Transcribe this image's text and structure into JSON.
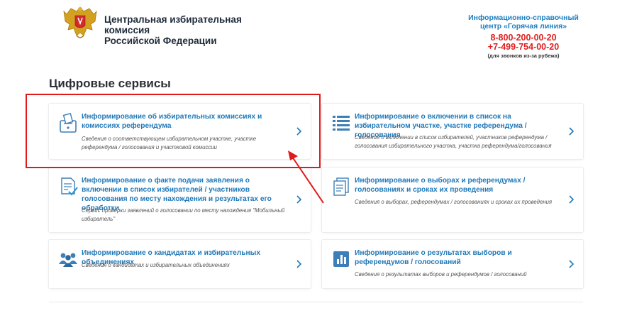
{
  "header": {
    "org_name_line1": "Центральная избирательная комиссия",
    "org_name_line2": "Российской Федерации",
    "hotline_title_line1": "Информационно-справочный",
    "hotline_title_line2": "центр «Горячая линия»",
    "phone1": "8-800-200-00-20",
    "phone2": "+7-499-754-00-20",
    "abroad_note": "(для звонков из-за рубежа)"
  },
  "section_title": "Цифровые сервисы",
  "cards": [
    {
      "title": "Информирование об избирательных комиссиях и комиссиях референдума",
      "desc": "Сведения о соответствующем избирательном участке, участке референдума / голосования и участковой комиссии",
      "icon": "ballot-box-icon"
    },
    {
      "title": "Информирование о включении в список на избирательном участке, участке референдума / голосования",
      "desc": "Сведения о включении в список избирателей, участников референдума / голосования избирательного участка, участка референдума/голосования",
      "icon": "list-icon"
    },
    {
      "title": "Информирование о факте подачи заявления о включении в список избирателей / участников голосования по месту нахождения и результатах его обработки",
      "desc": "Сервис проверки заявлений о голосовании по месту нахождения \"Мобильный избиратель\"",
      "icon": "document-check-icon"
    },
    {
      "title": "Информирование о выборах и референдумах / голосованиях и сроках их проведения",
      "desc": "Сведения о выборах, референдумах / голосованиях и сроках их проведения",
      "icon": "documents-icon"
    },
    {
      "title": "Информирование о кандидатах и избирательных объединениях",
      "desc": "Сведения о кандидатах и избирательных объединениях",
      "icon": "people-icon"
    },
    {
      "title": "Информирование о результатах выборов и референдумов / голосований",
      "desc": "Сведения о результатах выборов и референдумов / голосований",
      "icon": "bar-chart-icon"
    }
  ],
  "colors": {
    "accent": "#1f78b8",
    "phone": "#e02020",
    "highlight": "#e01919"
  }
}
